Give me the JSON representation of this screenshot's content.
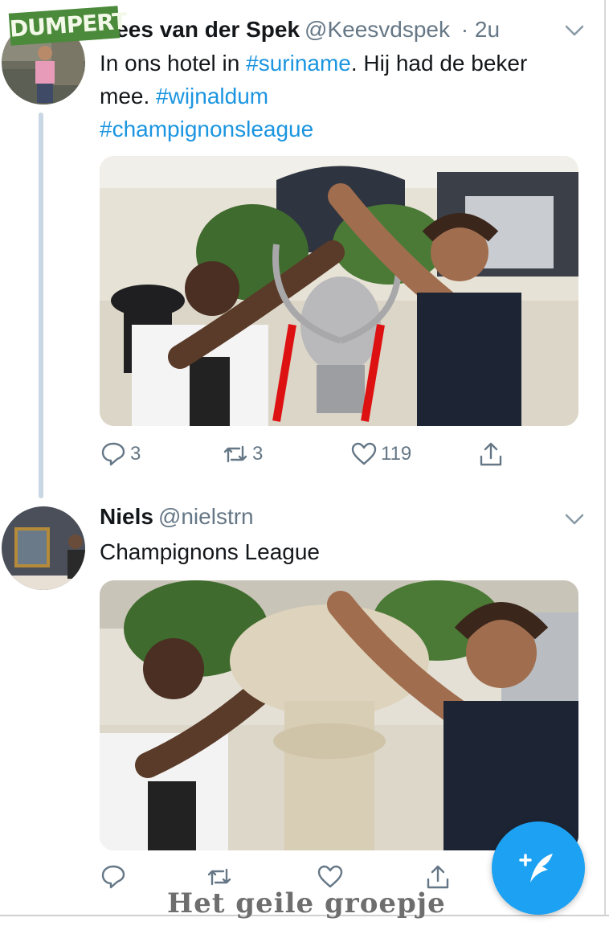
{
  "watermarks": {
    "top_left": "DUMPERT",
    "footer": "Het geile groepje"
  },
  "tweets": [
    {
      "name": "Kees van der Spek",
      "handle": "@Keesvdspek",
      "time": "· 2u",
      "text_parts": [
        {
          "text": "In ons hotel in ",
          "tag": false
        },
        {
          "text": "#suriname",
          "tag": true
        },
        {
          "text": ". Hij had de beker mee. ",
          "tag": false
        },
        {
          "text": "#wijnaldum",
          "tag": true
        },
        {
          "text": " ",
          "tag": false
        },
        {
          "text": "#champignonsleague",
          "tag": true
        }
      ],
      "media_icon": "champions-league-trophy-photo",
      "actions": {
        "replies": "3",
        "retweets": "3",
        "likes": "119"
      }
    },
    {
      "name": "Niels",
      "handle": "@nielstrn",
      "time": "",
      "text": "Champignons League",
      "media_icon": "giant-mushroom-photo",
      "actions": {
        "replies": "",
        "retweets": "",
        "likes": ""
      }
    }
  ],
  "icons": {
    "reply": "reply-icon",
    "retweet": "retweet-icon",
    "like": "heart-icon",
    "share": "share-icon",
    "menu": "chevron-down-icon",
    "compose": "compose-tweet-icon"
  },
  "colors": {
    "link": "#1b95e0",
    "fab": "#1da1f2",
    "muted": "#657786"
  }
}
